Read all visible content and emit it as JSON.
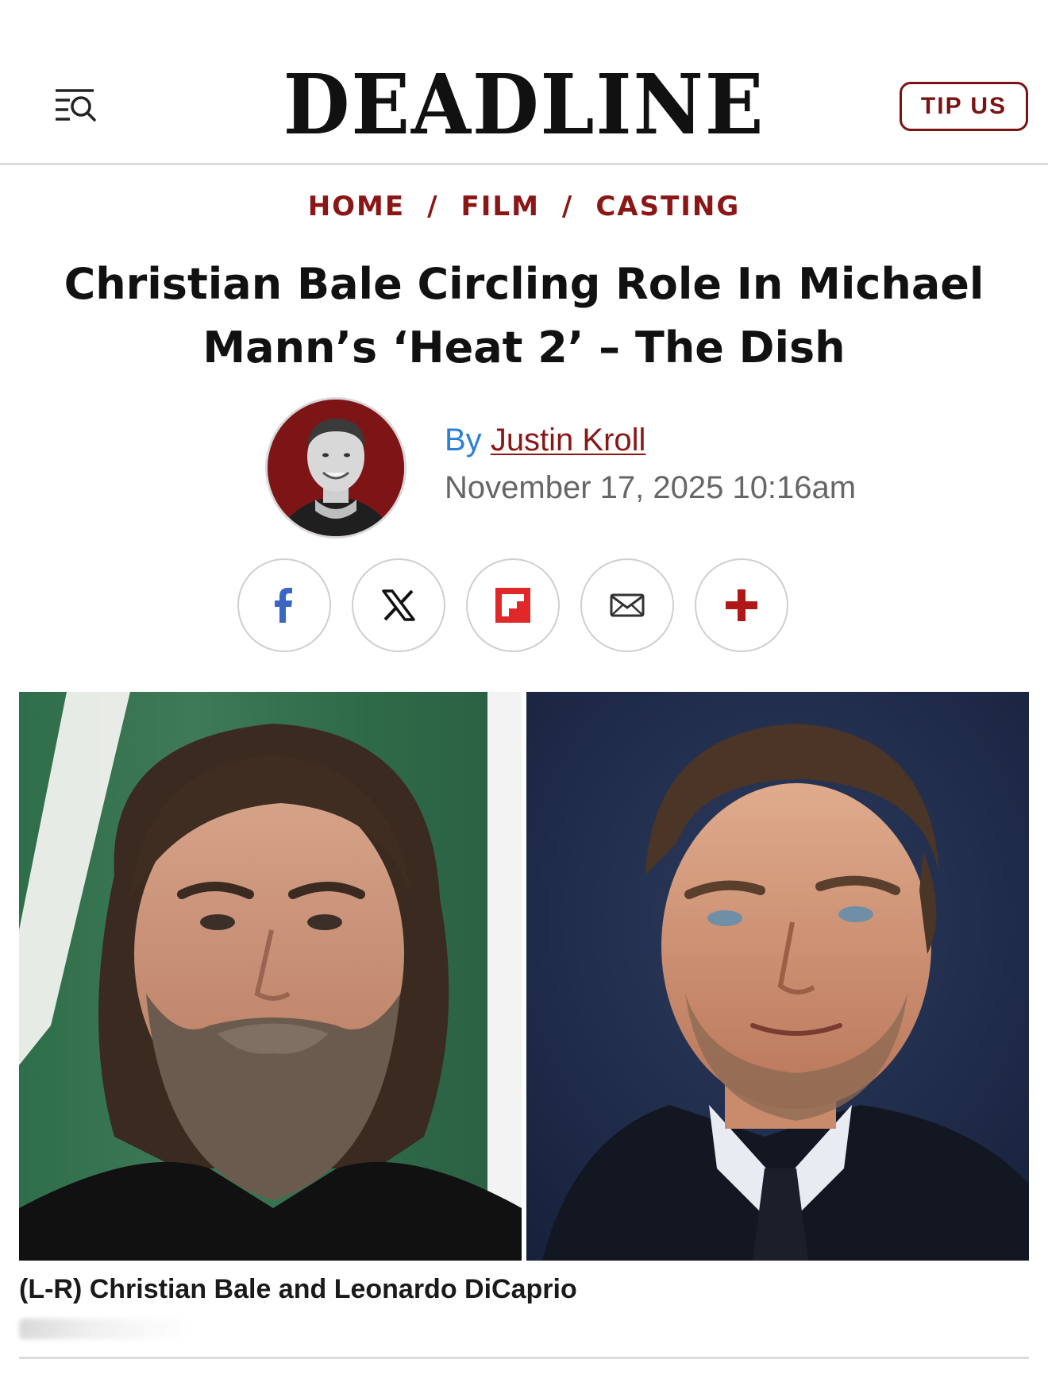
{
  "header": {
    "logo": "DEADLINE",
    "menu_icon": "menu-search-icon",
    "tip_label": "TIP US"
  },
  "breadcrumb": [
    {
      "label": "HOME"
    },
    {
      "label": "FILM"
    },
    {
      "label": "CASTING"
    }
  ],
  "breadcrumb_separator": "/",
  "article": {
    "title": "Christian Bale Circling Role In Michael Mann’s ‘Heat 2’ – The Dish",
    "byline_prefix": "By",
    "author": "Justin Kroll",
    "date": "November 17, 2025 10:16am"
  },
  "share": [
    {
      "name": "facebook",
      "icon": "facebook-icon"
    },
    {
      "name": "x",
      "icon": "x-icon"
    },
    {
      "name": "flipboard",
      "icon": "flipboard-icon"
    },
    {
      "name": "email",
      "icon": "email-icon"
    },
    {
      "name": "more",
      "icon": "plus-icon"
    }
  ],
  "hero": {
    "caption": "(L-R) Christian Bale and Leonardo DiCaprio"
  },
  "colors": {
    "brand_red": "#8a1616",
    "tip_border": "#7a1314",
    "byline_blue": "#2b7fd6",
    "facebook_blue": "#3b66c4",
    "flipboard_red": "#e12828",
    "plus_red": "#b01818"
  }
}
